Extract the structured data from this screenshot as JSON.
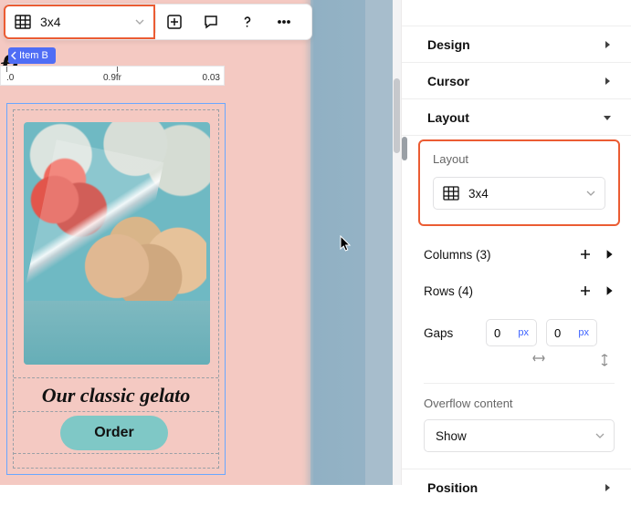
{
  "toolbar": {
    "grid_size": "3x4"
  },
  "breadcrumb": {
    "label": "Item B"
  },
  "ruler": {
    "t0": ".0",
    "t1": "0.9fr",
    "t2": "0.03"
  },
  "card": {
    "title": "Our classic gelato",
    "cta": "Order"
  },
  "panel": {
    "sections": {
      "design": "Design",
      "cursor": "Cursor",
      "layout": "Layout",
      "position": "Position"
    },
    "layout": {
      "label": "Layout",
      "value": "3x4",
      "columns_label": "Columns (3)",
      "rows_label": "Rows (4)",
      "gaps_label": "Gaps",
      "gap_h": "0",
      "gap_v": "0",
      "unit": "px"
    },
    "overflow": {
      "label": "Overflow content",
      "value": "Show"
    }
  }
}
